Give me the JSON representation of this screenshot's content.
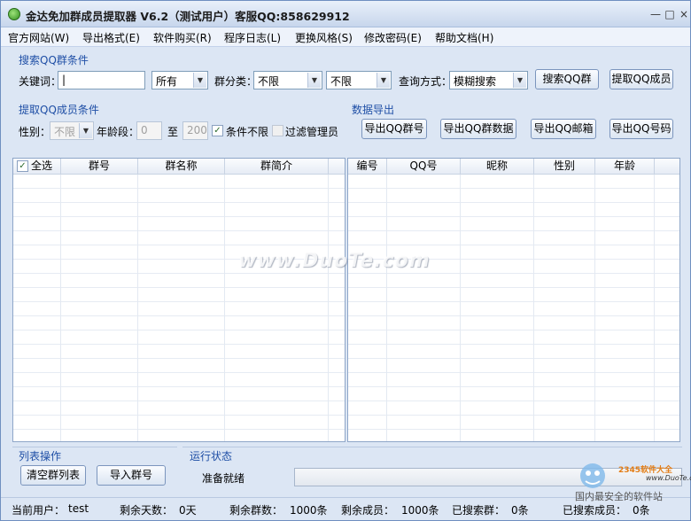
{
  "window": {
    "title": "金达免加群成员提取器 V6.2（测试用户）客服QQ:858629912",
    "minimize": "—",
    "maximize": "□",
    "close": "×"
  },
  "menu": [
    "官方网站(W)",
    "导出格式(E)",
    "软件购买(R)",
    "程序日志(L)",
    "更换风格(S)",
    "修改密码(E)",
    "帮助文档(H)"
  ],
  "search": {
    "group_title": "搜索QQ群条件",
    "keyword_label": "关键词：",
    "keyword_value": "|",
    "scope_value": "所有",
    "category_label": "群分类：",
    "category1_value": "不限",
    "category2_value": "不限",
    "query_mode_label": "查询方式：",
    "query_mode_value": "模糊搜索",
    "search_button": "搜索QQ群",
    "extract_button": "提取QQ成员"
  },
  "extract": {
    "group_title": "提取QQ成员条件",
    "gender_label": "性别：",
    "gender_value": "不限",
    "age_label": "年龄段：",
    "age_from": "0",
    "age_to_label": "至",
    "age_to": "200",
    "unlimited_checked": true,
    "unlimited_label": "条件不限",
    "filter_admin_checked": false,
    "filter_admin_label": "过滤管理员"
  },
  "export": {
    "group_title": "数据导出",
    "buttons": [
      "导出QQ群号",
      "导出QQ群数据",
      "导出QQ邮箱",
      "导出QQ号码"
    ]
  },
  "left_grid": {
    "select_all_label": "全选",
    "select_all_checked": true,
    "columns": [
      "群号",
      "群名称",
      "群简介"
    ]
  },
  "right_grid": {
    "columns": [
      "编号",
      "QQ号",
      "昵称",
      "性别",
      "年龄"
    ]
  },
  "list_ops": {
    "group_title": "列表操作",
    "clear_button": "清空群列表",
    "import_button": "导入群号"
  },
  "run_status": {
    "group_title": "运行状态",
    "status_text": "准备就绪",
    "progress": 0
  },
  "statusbar": {
    "current_user_label": "当前用户：",
    "current_user": "test",
    "days_label": "剩余天数：",
    "days": "0天",
    "groups_left_label": "剩余群数：",
    "groups_left": "1000条",
    "members_left_label": "剩余成员：",
    "members_left": "1000条",
    "searched_groups_label": "已搜索群：",
    "searched_groups": "0条",
    "searched_members_label": "已搜索成员：",
    "searched_members": "0条"
  },
  "watermark": {
    "text": "www.DuoTe.com",
    "corner_brand": "2345软件大全",
    "corner_url": "www.DuoTe.com",
    "corner_slogan": "国内最安全的软件站"
  },
  "colors": {
    "group_title": "#1f4fa6",
    "window_bg": "#dce6f4",
    "corner_brand": "#e37c14"
  }
}
